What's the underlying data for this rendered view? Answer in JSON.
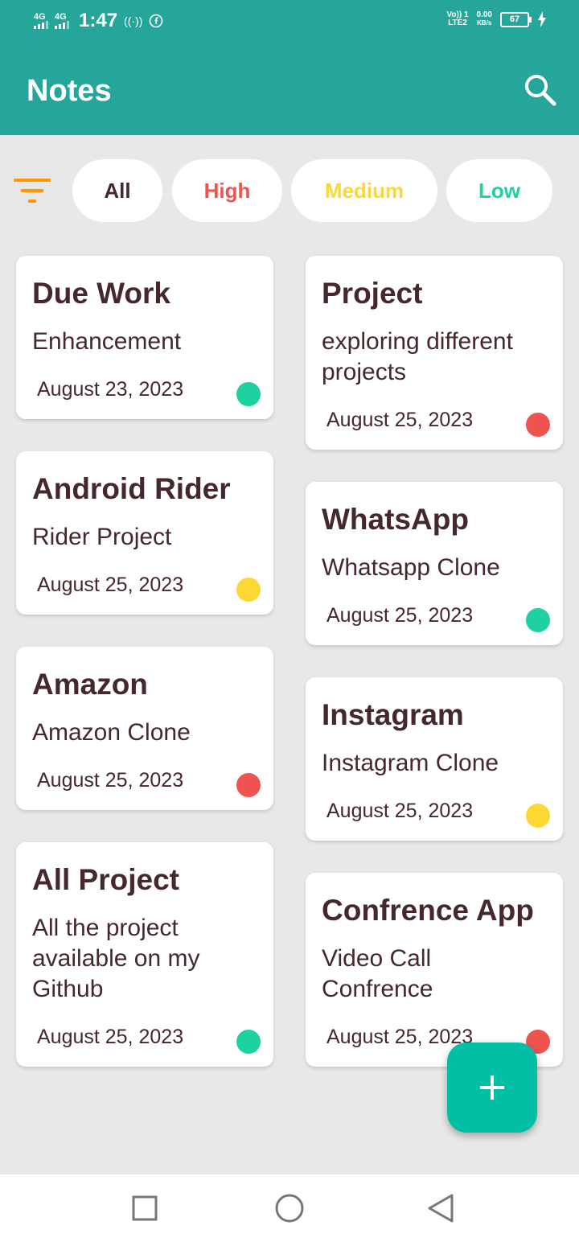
{
  "status_bar": {
    "net1": "4G",
    "net2": "4G",
    "time": "1:47",
    "volte": "Vo)) 1",
    "lte": "LTE2",
    "speed": "0.00",
    "speed_unit": "KB/s",
    "battery": "67"
  },
  "app": {
    "title": "Notes"
  },
  "filters": [
    {
      "label": "All",
      "color": "#45282c"
    },
    {
      "label": "High",
      "color": "#ef5350"
    },
    {
      "label": "Medium",
      "color": "#fdd835"
    },
    {
      "label": "Low",
      "color": "#1dd1a1"
    }
  ],
  "colors": {
    "primary": "#26a69a",
    "fab": "#00bfa5",
    "text": "#45282c",
    "filter_icon": "#ff9800",
    "priority_high": "#ef5350",
    "priority_medium": "#fdd835",
    "priority_low": "#1dd1a1"
  },
  "notes": [
    {
      "title": "Due Work",
      "body": "Enhancement",
      "date": "August 23, 2023",
      "priority": "low"
    },
    {
      "title": "Project",
      "body": "exploring different projects",
      "date": "August 25, 2023",
      "priority": "high"
    },
    {
      "title": "Android Rider",
      "body": "Rider Project",
      "date": "August 25, 2023",
      "priority": "medium"
    },
    {
      "title": "WhatsApp",
      "body": "Whatsapp Clone",
      "date": "August 25, 2023",
      "priority": "low"
    },
    {
      "title": "Amazon",
      "body": "Amazon Clone",
      "date": "August 25, 2023",
      "priority": "high"
    },
    {
      "title": "Instagram",
      "body": "Instagram Clone",
      "date": "August 25, 2023",
      "priority": "medium"
    },
    {
      "title": "All Project",
      "body": "All the project available on my Github",
      "date": "August 25, 2023",
      "priority": "low"
    },
    {
      "title": "Confrence App",
      "body": "Video Call Confrence",
      "date": "August 25, 2023",
      "priority": "high"
    }
  ],
  "icons": {
    "search": "search-icon",
    "filter": "filter-icon",
    "add": "plus-icon",
    "nav_recent": "square-icon",
    "nav_home": "circle-icon",
    "nav_back": "triangle-back-icon"
  }
}
